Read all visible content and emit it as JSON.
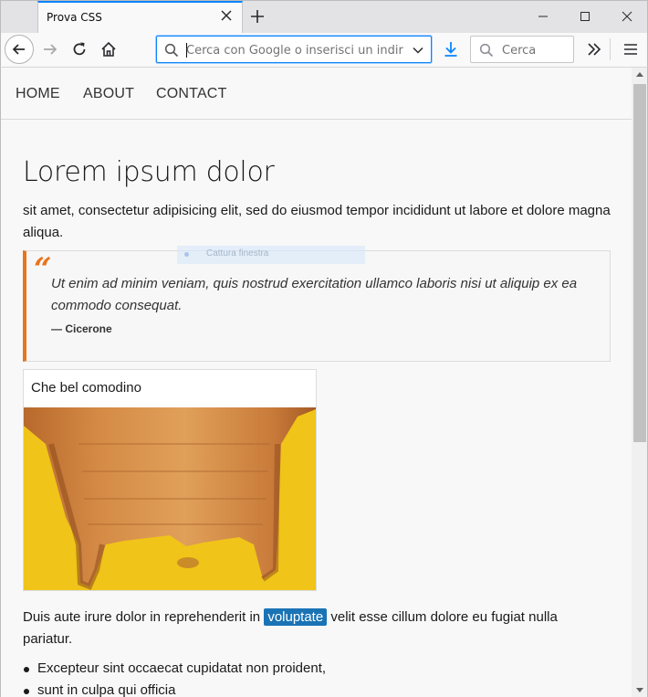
{
  "browser": {
    "tab_title": "Prova CSS",
    "url_placeholder": "Cerca con Google o inserisci un indirizzo",
    "search_placeholder": "Cerca",
    "accent_color": "#0a84ff"
  },
  "site": {
    "nav": [
      "HOME",
      "ABOUT",
      "CONTACT"
    ],
    "title": "Lorem ipsum dolor",
    "intro": "sit amet, consectetur adipisicing elit, sed do eiusmod tempor incididunt ut labore et dolore magna aliqua.",
    "quote": {
      "mark": "“",
      "text": "Ut enim ad minim veniam, quis nostrud exercitation ullamco laboris nisi ut aliquip ex ea commodo consequat.",
      "author": "— Cicerone",
      "accent_color": "#e9741c"
    },
    "card": {
      "title": "Che bel comodino",
      "image": "wooden-nightstand-image"
    },
    "paragraph": {
      "before": "Duis aute irure dolor in reprehenderit in ",
      "highlight": "voluptate",
      "after": " velit esse cillum dolore eu fugiat nulla pariatur."
    },
    "list": [
      "Excepteur sint occaecat cupidatat non proident,",
      "sunt in culpa qui officia"
    ]
  },
  "overlay": {
    "capture_label": "Cattura finestra"
  }
}
